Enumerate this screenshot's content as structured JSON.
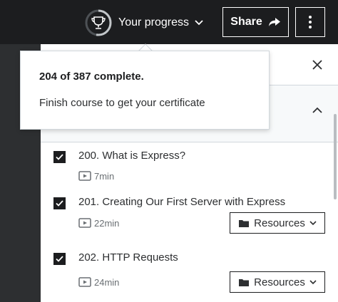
{
  "topbar": {
    "progress_label": "Your progress",
    "trophy_icon": "trophy-icon",
    "share_label": "Share",
    "share_icon": "share-arrow-icon",
    "more_icon": "vertical-dots-icon"
  },
  "progress": {
    "completed": 204,
    "total": 387,
    "fraction": 0.527
  },
  "popover": {
    "count_text": "204 of 387 complete.",
    "message": "Finish course to get your certificate"
  },
  "panel": {
    "close_icon": "close-icon",
    "section_chevron_icon": "chevron-up-icon"
  },
  "lectures": [
    {
      "title": "200. What is Express?",
      "duration": "7min",
      "checked": true,
      "has_resources": false
    },
    {
      "title": "201. Creating Our First Server with Express",
      "duration": "22min",
      "checked": true,
      "has_resources": true,
      "resources_label": "Resources"
    },
    {
      "title": "202. HTTP Requests",
      "duration": "24min",
      "checked": true,
      "has_resources": true,
      "resources_label": "Resources"
    }
  ],
  "colors": {
    "topbar_bg": "#1c1d1f",
    "ring_track": "#6a6f73",
    "ring_fill": "#d1d7dc",
    "accent_text": "#2d2f31"
  }
}
